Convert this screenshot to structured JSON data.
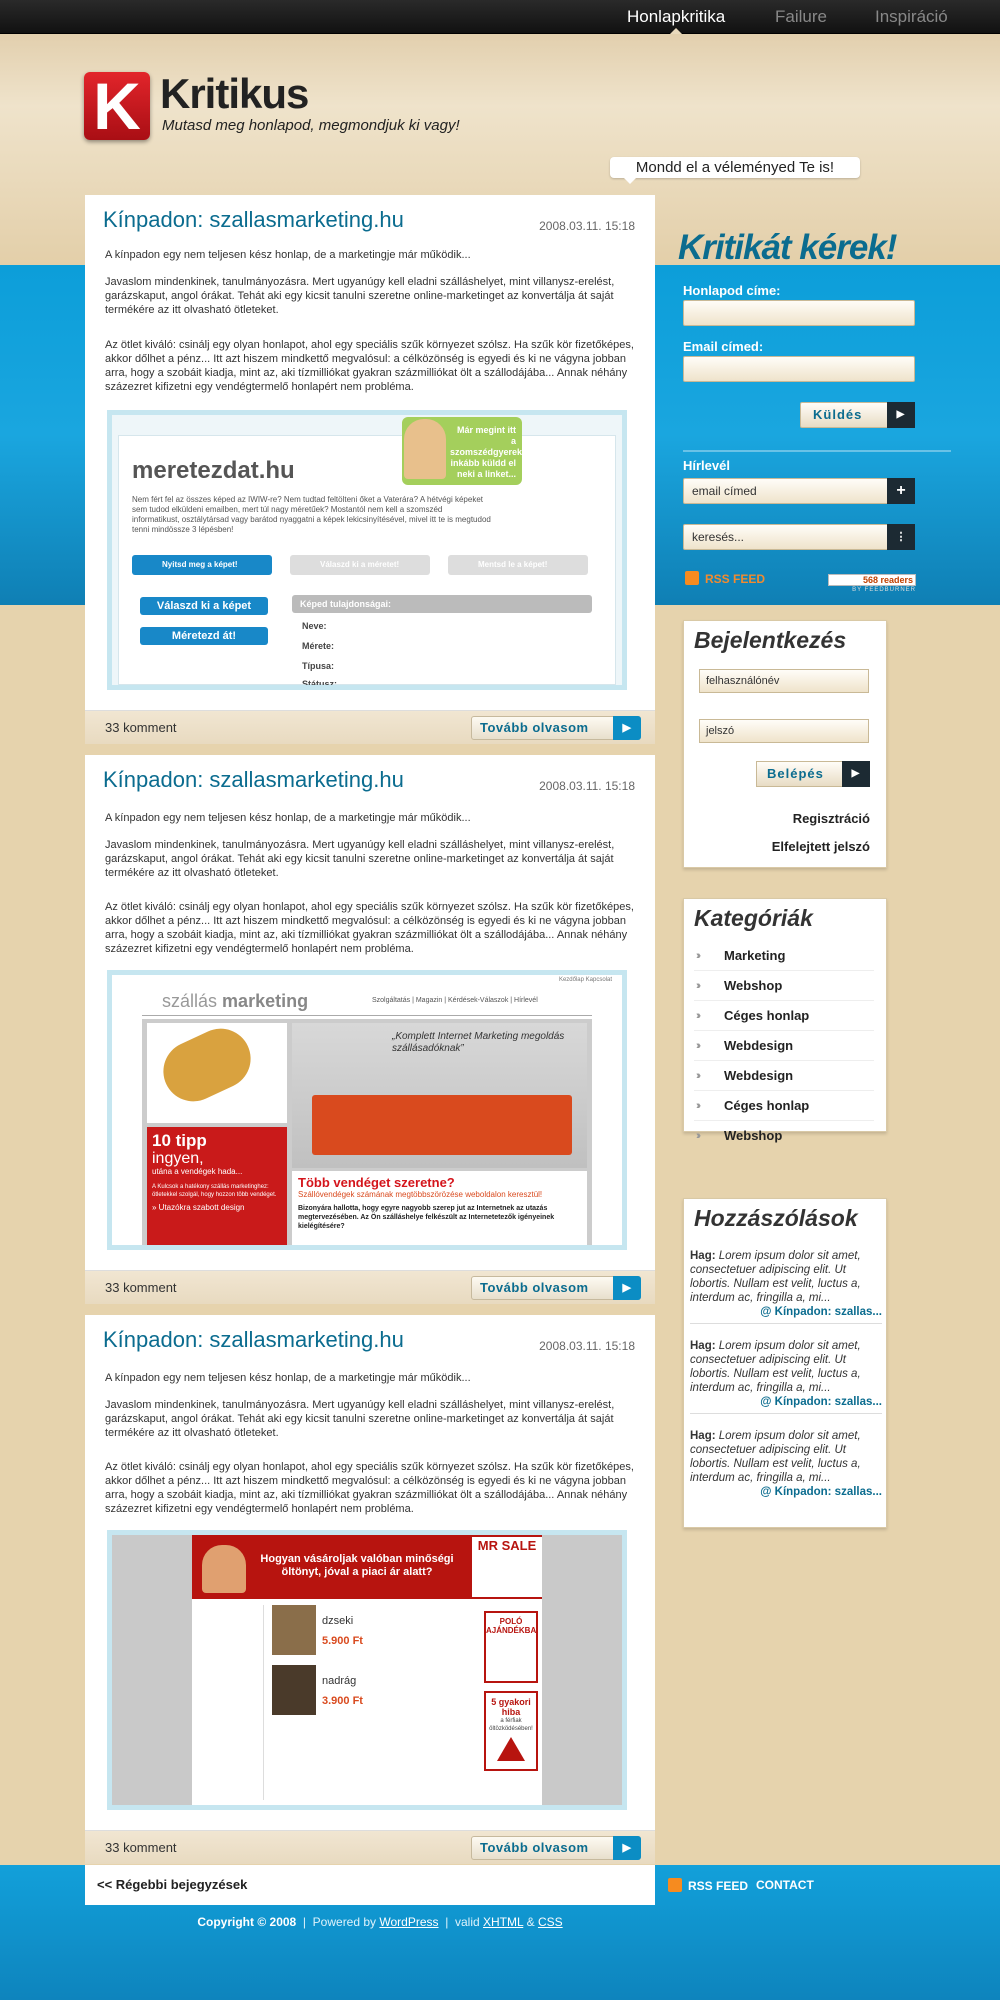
{
  "topnav": {
    "items": [
      "Honlapkritika",
      "Failure",
      "Inspiráció"
    ]
  },
  "logo": {
    "letter": "K",
    "title": "Kritikus",
    "tagline": "Mutasd meg honlapod, megmondjuk ki vagy!"
  },
  "header_bubble": "Mondd el a véleményed Te is!",
  "posts": [
    {
      "title": "Kínpadon: szallasmarketing.hu",
      "date": "2008.03.11. 15:18",
      "intro": "A kínpadon egy nem teljesen kész honlap, de a marketingje már működik...",
      "p1": "Javaslom mindenkinek, tanulmányozásra. Mert ugyanúgy kell eladni szálláshelyet, mint villanysz-erelést, garázskaput, angol órákat. Tehát aki egy kicsit tanulni szeretne online-marketinget az konvertálja át saját termékére az itt olvasható ötleteket.",
      "p2": "Az ötlet kiváló: csinálj egy olyan honlapot, ahol egy speciális szűk környezet szólsz. Ha szűk kör fizetőképes, akkor dőlhet a pénz... Itt azt hiszem mindkettő megvalósul: a célközönség is egyedi és ki ne vágyna jobban arra, hogy a szobáit kiadja, mint az, aki tízmilliókat gyakran százmilliókat ölt a szállodájába... Annak néhány százezret kifizetni egy vendégtermelő honlapért nem probléma.",
      "comments": "33 komment",
      "more": "Tovább olvasom",
      "shot": {
        "brand": "meretezdat.hu",
        "bubble": "Már megint itt a szomszédgyerek, inkább küldd el neki a linket...",
        "text": "Nem fért fel az összes képed az IWIW-re? Nem tudtad feltölteni őket a Vaterára? A hétvégi képeket sem tudod elküldeni emailben, mert túl nagy méretűek? Mostantól nem kell a szomszéd informatikust, osztálytársad vagy barátod nyaggatni a képek lekicsinyítésével, mivel itt te is megtudod tenni mindössze 3 lépésben!",
        "steps": [
          "Nyitsd meg a képet!",
          "Válaszd ki a méretet!",
          "Mentsd le a képet!"
        ],
        "btn1": "Válaszd ki a képet",
        "btn2": "Méretezd át!",
        "props_title": "Képed tulajdonságai:",
        "props": [
          "Neve:",
          "Mérete:",
          "Típusa:",
          "Státusz:"
        ]
      }
    },
    {
      "title": "Kínpadon: szallasmarketing.hu",
      "date": "2008.03.11. 15:18",
      "intro": "A kínpadon egy nem teljesen kész honlap, de a marketingje már működik...",
      "p1": "Javaslom mindenkinek, tanulmányozásra. Mert ugyanúgy kell eladni szálláshelyet, mint villanysz-erelést, garázskaput, angol órákat. Tehát aki egy kicsit tanulni szeretne online-marketinget az konvertálja át saját termékére az itt olvasható ötleteket.",
      "p2": "Az ötlet kiváló: csinálj egy olyan honlapot, ahol egy speciális szűk környezet szólsz. Ha szűk kör fizetőképes, akkor dőlhet a pénz... Itt azt hiszem mindkettő megvalósul: a célközönség is egyedi és ki ne vágyna jobban arra, hogy a szobáit kiadja, mint az, aki tízmilliókat gyakran százmilliókat ölt a szállodájába... Annak néhány százezret kifizetni egy vendégtermelő honlapért nem probléma.",
      "comments": "33 komment",
      "more": "Tovább olvasom",
      "shot": {
        "top": "Kezdőlap Kapcsolat",
        "brand1": "szállás",
        "brand2": "marketing",
        "menu": "Szolgáltatás | Magazin | Kérdések-Válaszok | Hírlevél",
        "quote": "„Komplett Internet Marketing megoldás szállásadóknak”",
        "tip1": "10 tipp",
        "tip2": "ingyen,",
        "tip3": "utána a vendégek hada...",
        "tip_small": "A Kulcsok a hatékony szállás marketinghez: ötletekkel szolgál, hogy hozzon több vendéget.",
        "tip_link": "» Utazókra szabott design",
        "headline": "Több vendéget szeretne?",
        "sub": "Szállóvendégek számának megtöbbszörözése weboldalon keresztül!",
        "body": "Bizonyára hallotta, hogy egyre nagyobb szerep jut az Internetnek az utazás megtervezésében. Az Ön szálláshelye felkészült az Internetetezők igényeinek kielégítésére?"
      }
    },
    {
      "title": "Kínpadon: szallasmarketing.hu",
      "date": "2008.03.11. 15:18",
      "intro": "A kínpadon egy nem teljesen kész honlap, de a marketingje már működik...",
      "p1": "Javaslom mindenkinek, tanulmányozásra. Mert ugyanúgy kell eladni szálláshelyet, mint villanysz-erelést, garázskaput, angol órákat. Tehát aki egy kicsit tanulni szeretne online-marketinget az konvertálja át saját termékére az itt olvasható ötleteket.",
      "p2": "Az ötlet kiváló: csinálj egy olyan honlapot, ahol egy speciális szűk környezet szólsz. Ha szűk kör fizetőképes, akkor dőlhet a pénz... Itt azt hiszem mindkettő megvalósul: a célközönség is egyedi és ki ne vágyna jobban arra, hogy a szobáit kiadja, mint az, aki tízmilliókat gyakran százmilliókat ölt a szállodájába... Annak néhány százezret kifizetni egy vendégtermelő honlapért nem probléma.",
      "comments": "33 komment",
      "more": "Tovább olvasom",
      "shot": {
        "brand": "MR SALE",
        "headline": "Hogyan vásároljak valóban minőségi öltönyt, jóval a piaci ár alatt?",
        "product1": "dzseki",
        "price1": "5.900 Ft",
        "product2": "nadrág",
        "price2": "3.900 Ft",
        "promo1": "POLÓ AJÁNDÉKBA",
        "promo2": "5 gyakori hiba",
        "promo2b": "a férfiak öltözködésében!"
      }
    }
  ],
  "older_link": "<< Régebbi bejegyzések",
  "sidebar": {
    "title": "Kritikát kérek!",
    "site_label": "Honlapod címe:",
    "email_label": "Email címed:",
    "send": "Küldés",
    "newsletter_label": "Hírlevél",
    "newsletter_placeholder": "email címed",
    "search_placeholder": "keresés...",
    "rss": "RSS FEED",
    "readers": "568 readers",
    "readers_sub": "BY FEEDBURNER"
  },
  "login": {
    "title": "Bejelentkezés",
    "user_placeholder": "felhasználónév",
    "pass_placeholder": "jelszó",
    "button": "Belépés",
    "register": "Regisztráció",
    "forgot": "Elfelejtett jelszó"
  },
  "categories": {
    "title": "Kategóriák",
    "items": [
      "Marketing",
      "Webshop",
      "Céges honlap",
      "Webdesign",
      "Webdesign",
      "Céges honlap",
      "Webshop"
    ]
  },
  "comments_box": {
    "title": "Hozzászólások",
    "items": [
      {
        "author": "Hag:",
        "text": "Lorem ipsum dolor sit amet, consectetuer adipiscing elit. Ut lobortis. Nullam est velit, luctus a, interdum ac, fringilla a, mi...",
        "link": "@ Kínpadon: szallas..."
      },
      {
        "author": "Hag:",
        "text": "Lorem ipsum dolor sit amet, consectetuer adipiscing elit. Ut lobortis. Nullam est velit, luctus a, interdum ac, fringilla a, mi...",
        "link": "@ Kínpadon: szallas..."
      },
      {
        "author": "Hag:",
        "text": "Lorem ipsum dolor sit amet, consectetuer adipiscing elit. Ut lobortis. Nullam est velit, luctus a, interdum ac, fringilla a, mi...",
        "link": "@ Kínpadon: szallas..."
      }
    ]
  },
  "footer": {
    "rss": "RSS FEED",
    "contact": "CONTACT",
    "copyright": "Copyright © 2008",
    "powered": "Powered by",
    "wordpress": "WordPress",
    "valid": "valid",
    "xhtml": "XHTML",
    "amp": "&",
    "css": "CSS"
  },
  "colors": {
    "accent": "#0b6c8f",
    "blue_band": "#0c9ed9",
    "beige": "#e6d3ad",
    "logo_red": "#d4151c",
    "rss_orange": "#f28a2f"
  }
}
